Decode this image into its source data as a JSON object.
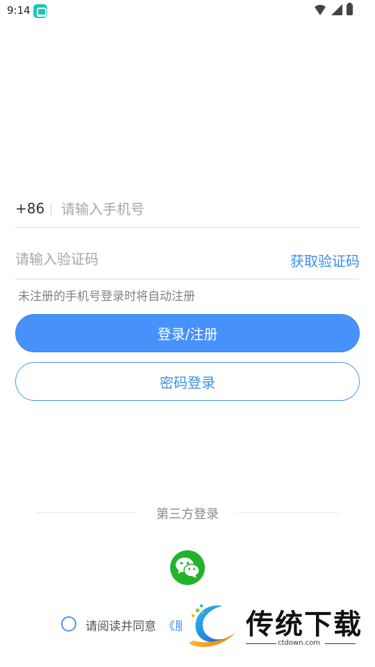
{
  "status_bar": {
    "time": "9:14"
  },
  "login": {
    "country_code": "+86",
    "phone_placeholder": "请输入手机号",
    "code_placeholder": "请输入验证码",
    "get_code_label": "获取验证码",
    "hint": "未注册的手机号登录时将自动注册",
    "login_button": "登录/注册",
    "password_login_button": "密码登录"
  },
  "third_party": {
    "title": "第三方登录"
  },
  "agreement": {
    "text": "请阅读并同意",
    "link_text": "《服"
  },
  "watermark": {
    "title": "传统下载",
    "site": "ctdown.com"
  },
  "colors": {
    "accent": "#4791fb",
    "link": "#3b8ee8",
    "wechat": "#22b32a"
  }
}
